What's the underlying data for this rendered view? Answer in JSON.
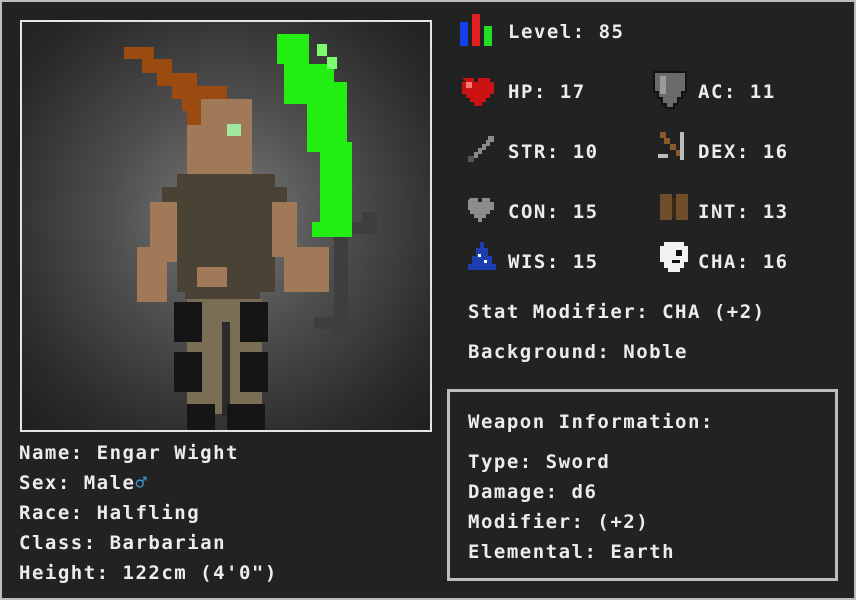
{
  "character": {
    "name_label": "Name: Engar Wight",
    "sex_label": "Sex: Male",
    "sex_symbol": "♂",
    "race_label": "Race: Halfling",
    "class_label": "Class: Barbarian",
    "height_label": "Height: 122cm (4'0\")"
  },
  "stats": {
    "level": "Level: 85",
    "hp": "HP: 17",
    "ac": "AC: 11",
    "str": "STR: 10",
    "dex": "DEX: 16",
    "con": "CON: 15",
    "int": "INT: 13",
    "wis": "WIS: 15",
    "cha": "CHA: 16",
    "stat_modifier": "Stat Modifier: CHA (+2)",
    "background": "Background: Noble"
  },
  "weapon": {
    "heading": "Weapon Information:",
    "type": "Type: Sword",
    "damage": "Damage: d6",
    "modifier": "Modifier: (+2)",
    "elemental": "Elemental: Earth"
  },
  "icons": {
    "level": "level-bars-icon",
    "hp": "heart-icon",
    "ac": "shield-icon",
    "str": "sword-icon",
    "dex": "bow-icon",
    "con": "grey-heart-icon",
    "int": "book-icon",
    "wis": "wizard-hat-icon",
    "cha": "mask-icon"
  },
  "colors": {
    "background": "#222222",
    "frame": "#bdbdbd",
    "text": "#ececec",
    "sex_symbol": "#3b9bdc",
    "blade": "#22ee11",
    "hair": "#9b4a10",
    "skin": "#a07a58"
  }
}
